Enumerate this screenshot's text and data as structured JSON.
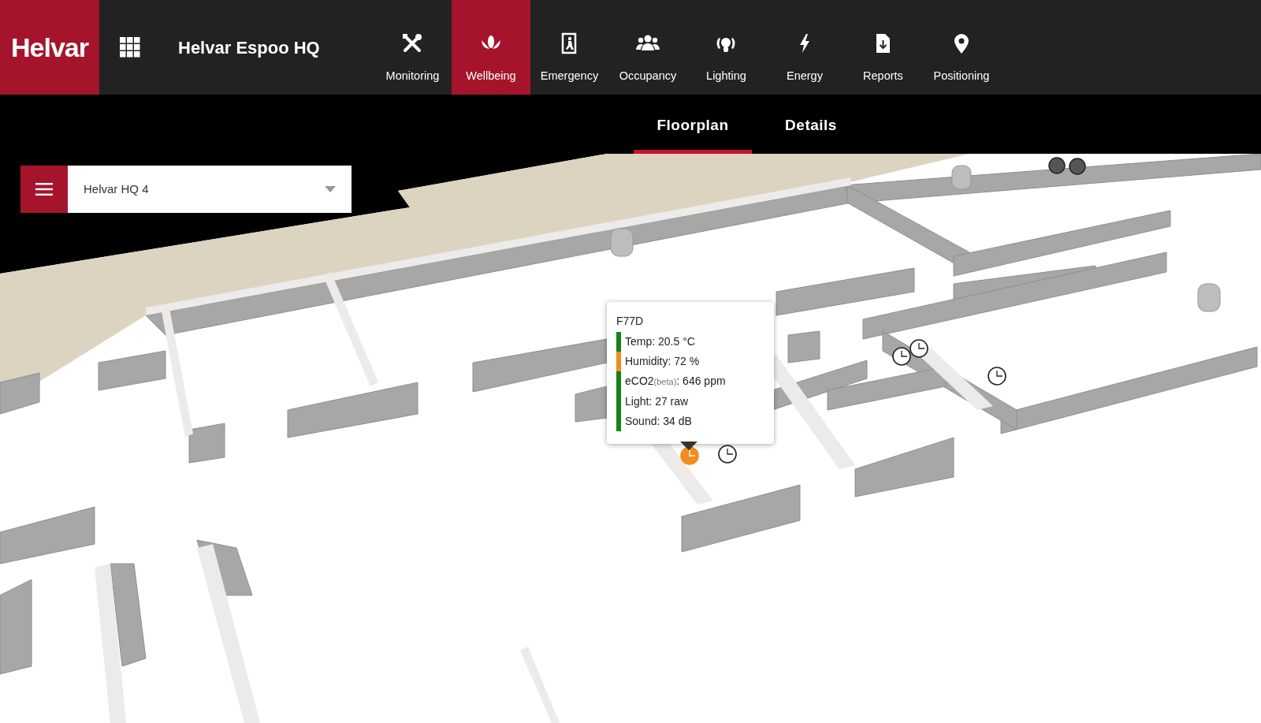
{
  "brand": {
    "logo": "Helvar",
    "site_title": "Helvar Espoo HQ"
  },
  "nav": [
    {
      "label": "Monitoring",
      "selected": false
    },
    {
      "label": "Wellbeing",
      "selected": true
    },
    {
      "label": "Emergency",
      "selected": false
    },
    {
      "label": "Occupancy",
      "selected": false
    },
    {
      "label": "Lighting",
      "selected": false
    },
    {
      "label": "Energy",
      "selected": false
    },
    {
      "label": "Reports",
      "selected": false
    },
    {
      "label": "Positioning",
      "selected": false
    }
  ],
  "tabs": [
    {
      "label": "Floorplan",
      "selected": true
    },
    {
      "label": "Details",
      "selected": false
    }
  ],
  "floor_select": {
    "value": "Helvar HQ 4"
  },
  "sensors": [
    {
      "selected": true
    },
    {
      "selected": false
    },
    {
      "selected": false
    },
    {
      "selected": false
    },
    {
      "selected": false
    }
  ],
  "tooltip": {
    "title": "F77D",
    "readings": [
      {
        "text": "Temp: 20.5 °C",
        "color": "#178217"
      },
      {
        "text": "Humidity: 72 %",
        "color": "#f28c1c"
      },
      {
        "text": "eCO2",
        "note": "(beta)",
        "suffix": ": 646 ppm",
        "color": "#178217"
      },
      {
        "text": "Light: 27 raw",
        "color": "#178217"
      },
      {
        "text": "Sound: 34 dB",
        "color": "#178217"
      }
    ]
  }
}
